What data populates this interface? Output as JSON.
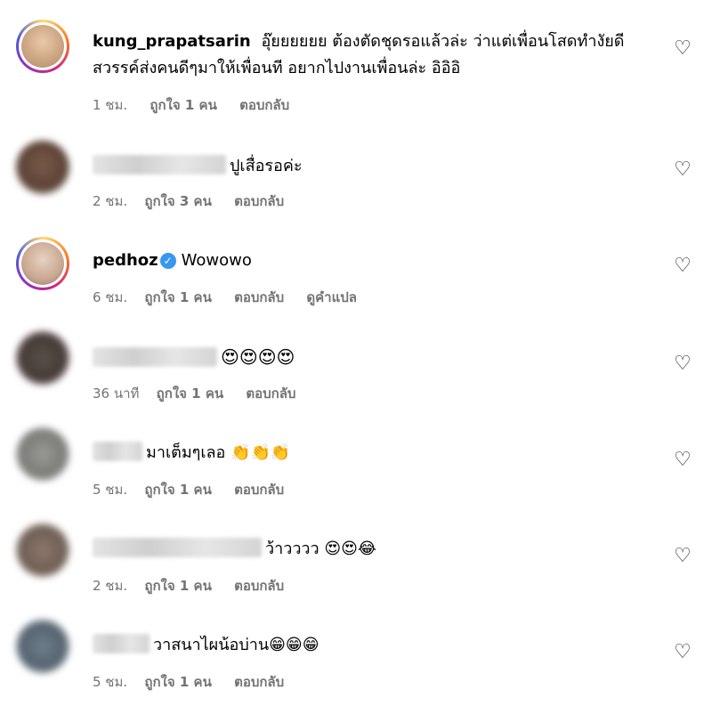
{
  "comments": [
    {
      "username": "kung_prapatsarin",
      "text": "อุ๊ยยยยยย ต้องตัดชุดรอแล้วล่ะ ว่าแต่เพื่อนโสดทำงัยดี สวรรค์ส่งคนดีๆมาให้เพื่อนที อยากไปงานเพื่อนล่ะ อิอิอิ",
      "time": "1 ชม.",
      "likes": "ถูกใจ 1 คน",
      "reply": "ตอบกลับ"
    },
    {
      "username": "",
      "text": "ปูเสื่อรอค่ะ",
      "time": "2 ชม.",
      "likes": "ถูกใจ 3 คน",
      "reply": "ตอบกลับ"
    },
    {
      "username": "pedhoz",
      "verified_icon": "verified-badge-icon",
      "text": "Wowowo",
      "time": "6 ชม.",
      "likes": "ถูกใจ 1 คน",
      "reply": "ตอบกลับ",
      "translate": "ดูคำแปล"
    },
    {
      "username": "",
      "text": "😍😍😍😍",
      "time": "36 นาที",
      "likes": "ถูกใจ 1 คน",
      "reply": "ตอบกลับ"
    },
    {
      "username": "",
      "text": "มาเต็มๆเลอ 👏👏👏",
      "time": "5 ชม.",
      "likes": "ถูกใจ 1 คน",
      "reply": "ตอบกลับ"
    },
    {
      "username": "",
      "text": "ว้าวววว 😍😍😂",
      "time": "2 ชม.",
      "likes": "ถูกใจ 1 คน",
      "reply": "ตอบกลับ"
    },
    {
      "username": "",
      "text": "วาสนาไผน้อบ่าน😁😁😁",
      "time": "5 ชม.",
      "likes": "ถูกใจ 1 คน",
      "reply": "ตอบกลับ"
    }
  ],
  "icons": {
    "like": "heart-outline-icon"
  },
  "colors": {
    "meta_text": "#737373",
    "verified": "#3897f0"
  }
}
